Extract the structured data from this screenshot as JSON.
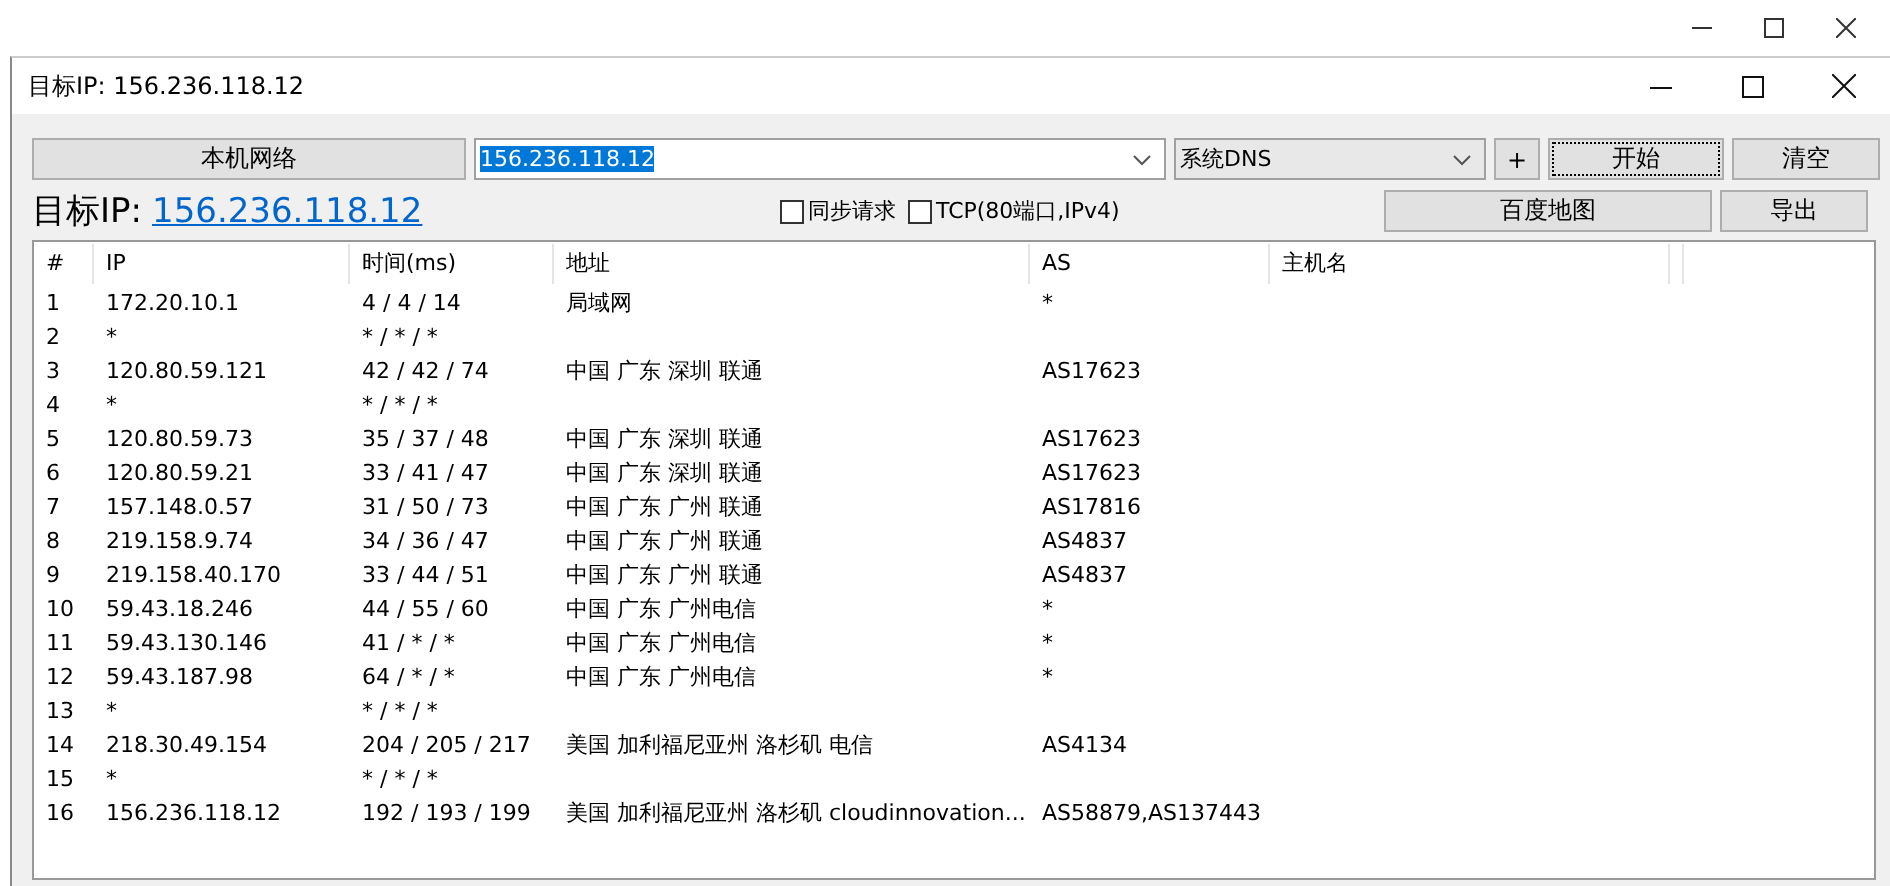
{
  "window": {
    "title": "目标IP: 156.236.118.12"
  },
  "toolbar": {
    "network_button": "本机网络",
    "target_field": {
      "value": "156.236.118.12",
      "selected": true
    },
    "dns_select": "系统DNS",
    "add_button": "+",
    "start_button": {
      "label": "开始",
      "focused": true
    },
    "clear_button": "清空",
    "map_button": "百度地图",
    "export_button": "导出"
  },
  "target": {
    "label": "目标IP:",
    "link": "156.236.118.12"
  },
  "options": [
    {
      "label": "同步请求",
      "checked": false
    },
    {
      "label": "TCP(80端口,IPv4)",
      "checked": false
    }
  ],
  "table": {
    "columns": [
      "#",
      "IP",
      "时间(ms)",
      "地址",
      "AS",
      "主机名"
    ],
    "rows": [
      [
        "1",
        "172.20.10.1",
        "4 / 4 / 14",
        "局域网",
        "*",
        ""
      ],
      [
        "2",
        "*",
        "* / * / *",
        "",
        "",
        ""
      ],
      [
        "3",
        "120.80.59.121",
        "42 / 42 / 74",
        "中国 广东 深圳 联通",
        "AS17623",
        ""
      ],
      [
        "4",
        "*",
        "* / * / *",
        "",
        "",
        ""
      ],
      [
        "5",
        "120.80.59.73",
        "35 / 37 / 48",
        "中国 广东 深圳 联通",
        "AS17623",
        ""
      ],
      [
        "6",
        "120.80.59.21",
        "33 / 41 / 47",
        "中国 广东 深圳 联通",
        "AS17623",
        ""
      ],
      [
        "7",
        "157.148.0.57",
        "31 / 50 / 73",
        "中国 广东 广州 联通",
        "AS17816",
        ""
      ],
      [
        "8",
        "219.158.9.74",
        "34 / 36 / 47",
        "中国 广东 广州 联通",
        "AS4837",
        ""
      ],
      [
        "9",
        "219.158.40.170",
        "33 / 44 / 51",
        "中国 广东 广州 联通",
        "AS4837",
        ""
      ],
      [
        "10",
        "59.43.18.246",
        "44 / 55 / 60",
        "中国 广东 广州电信",
        "*",
        ""
      ],
      [
        "11",
        "59.43.130.146",
        "41 / * / *",
        "中国 广东 广州电信",
        "*",
        ""
      ],
      [
        "12",
        "59.43.187.98",
        "64 / * / *",
        "中国 广东 广州电信",
        "*",
        ""
      ],
      [
        "13",
        "*",
        "* / * / *",
        "",
        "",
        ""
      ],
      [
        "14",
        "218.30.49.154",
        "204 / 205 / 217",
        "美国 加利福尼亚州 洛杉矶 电信",
        "AS4134",
        ""
      ],
      [
        "15",
        "*",
        "* / * / *",
        "",
        "",
        ""
      ],
      [
        "16",
        "156.236.118.12",
        "192 / 193 / 199",
        "美国 加利福尼亚州 洛杉矶 cloudinnovation...",
        "AS58879,AS137443",
        ""
      ]
    ]
  }
}
